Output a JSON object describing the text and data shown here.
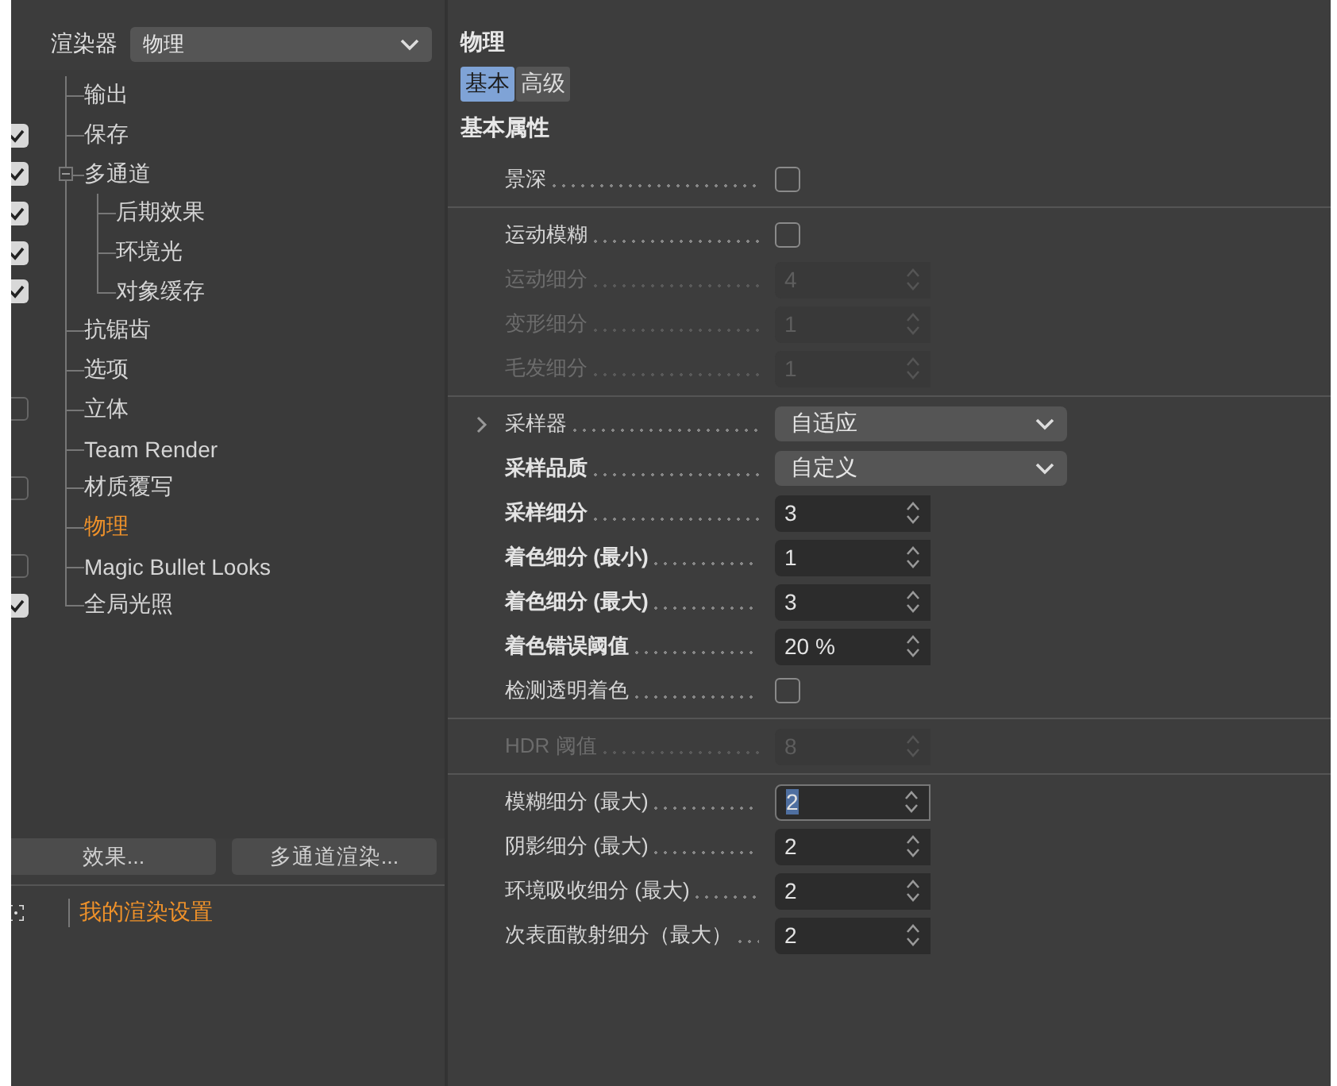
{
  "renderer": {
    "label": "渲染器",
    "value": "物理"
  },
  "tree": [
    {
      "label": "输出",
      "kind": "plain",
      "selected": false
    },
    {
      "label": "保存",
      "kind": "checkbox",
      "checked": true,
      "selected": false
    },
    {
      "label": "多通道",
      "kind": "checkbox",
      "checked": true,
      "selected": false,
      "expanded": true,
      "children": [
        {
          "label": "后期效果",
          "kind": "checkbox",
          "checked": true,
          "selected": false
        },
        {
          "label": "环境光",
          "kind": "checkbox",
          "checked": true,
          "selected": false
        },
        {
          "label": "对象缓存",
          "kind": "checkbox",
          "checked": true,
          "selected": false
        }
      ]
    },
    {
      "label": "抗锯齿",
      "kind": "plain",
      "selected": false
    },
    {
      "label": "选项",
      "kind": "plain",
      "selected": false
    },
    {
      "label": "立体",
      "kind": "checkbox",
      "checked": false,
      "selected": false
    },
    {
      "label": "Team Render",
      "kind": "plain",
      "selected": false
    },
    {
      "label": "材质覆写",
      "kind": "checkbox",
      "checked": false,
      "selected": false
    },
    {
      "label": "物理",
      "kind": "plain",
      "selected": true
    },
    {
      "label": "Magic Bullet Looks",
      "kind": "checkbox",
      "checked": false,
      "selected": false
    },
    {
      "label": "全局光照",
      "kind": "checkbox",
      "checked": true,
      "selected": false
    }
  ],
  "buttons": [
    "效果...",
    "多通道渲染..."
  ],
  "render_settings": [
    {
      "label": "我的渲染设置",
      "selected": true
    }
  ],
  "panel": {
    "title": "物理",
    "tabs": [
      {
        "label": "基本",
        "selected": true
      },
      {
        "label": "高级",
        "selected": false
      }
    ],
    "section": "基本属性",
    "groups": [
      [
        {
          "label": "景深",
          "kind": "checkbox",
          "checked": false,
          "disabled": false,
          "modified": false
        }
      ],
      [
        {
          "label": "运动模糊",
          "kind": "checkbox",
          "checked": false,
          "disabled": false,
          "modified": false
        },
        {
          "label": "运动细分",
          "kind": "spinner",
          "value": "4",
          "disabled": true,
          "modified": false,
          "focused": false
        },
        {
          "label": "变形细分",
          "kind": "spinner",
          "value": "1",
          "disabled": true,
          "modified": false,
          "focused": false
        },
        {
          "label": "毛发细分",
          "kind": "spinner",
          "value": "1",
          "disabled": true,
          "modified": false,
          "focused": false
        }
      ],
      [
        {
          "label": "采样器",
          "kind": "dropdown",
          "value": "自适应",
          "disabled": false,
          "modified": false,
          "expanded": false
        },
        {
          "label": "采样品质",
          "kind": "dropdown",
          "value": "自定义",
          "disabled": false,
          "modified": true
        },
        {
          "label": "采样细分",
          "kind": "spinner",
          "value": "3",
          "disabled": false,
          "modified": true,
          "focused": false
        },
        {
          "label": "着色细分 (最小)",
          "kind": "spinner",
          "value": "1",
          "disabled": false,
          "modified": true,
          "focused": false
        },
        {
          "label": "着色细分 (最大)",
          "kind": "spinner",
          "value": "3",
          "disabled": false,
          "modified": true,
          "focused": false
        },
        {
          "label": "着色错误阈值",
          "kind": "spinner",
          "value": "20 %",
          "disabled": false,
          "modified": true,
          "focused": false
        },
        {
          "label": "检测透明着色",
          "kind": "checkbox",
          "checked": false,
          "disabled": false,
          "modified": false
        }
      ],
      [
        {
          "label": "HDR 阈值",
          "kind": "spinner",
          "value": "8",
          "disabled": true,
          "modified": false,
          "focused": false
        }
      ],
      [
        {
          "label": "模糊细分 (最大)",
          "kind": "spinner",
          "value": "2",
          "disabled": false,
          "modified": false,
          "focused": true
        },
        {
          "label": "阴影细分 (最大)",
          "kind": "spinner",
          "value": "2",
          "disabled": false,
          "modified": false,
          "focused": false
        },
        {
          "label": "环境吸收细分 (最大)",
          "kind": "spinner",
          "value": "2",
          "disabled": false,
          "modified": false,
          "focused": false
        },
        {
          "label": "次表面散射细分（最大）",
          "kind": "spinner",
          "value": "2",
          "disabled": false,
          "modified": false,
          "focused": false
        }
      ]
    ]
  }
}
